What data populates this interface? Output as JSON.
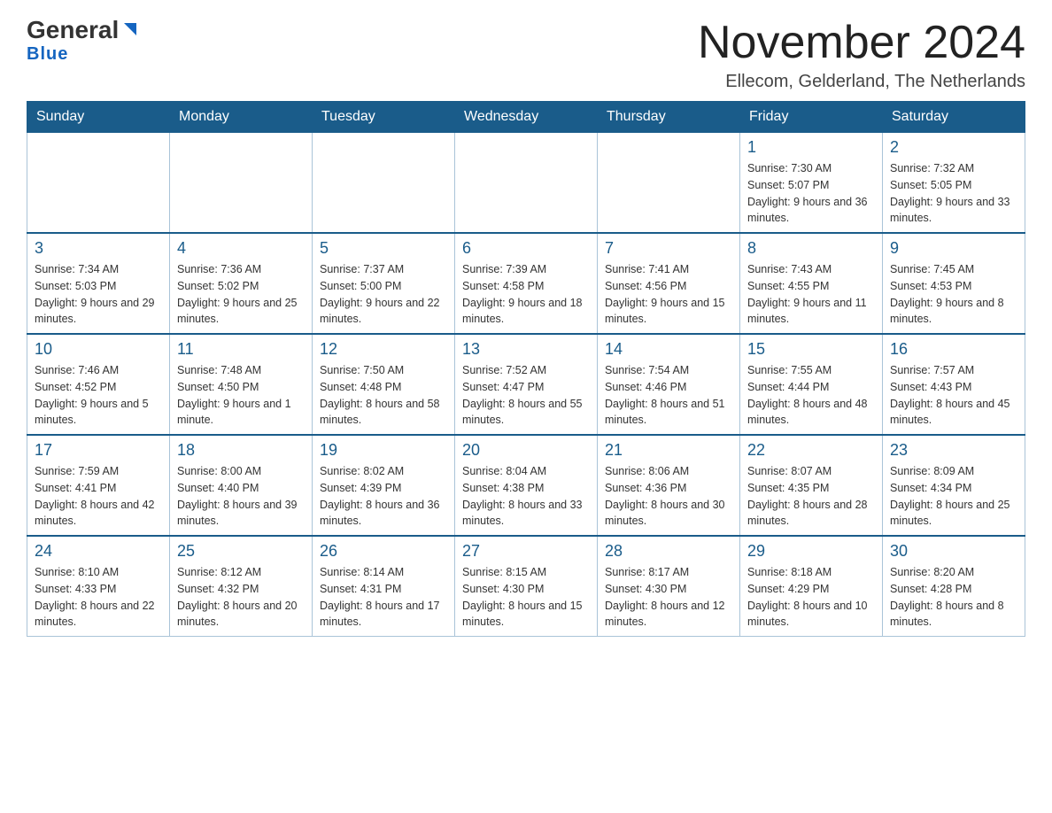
{
  "logo": {
    "name_part1": "General",
    "name_part2": "Blue"
  },
  "title": "November 2024",
  "subtitle": "Ellecom, Gelderland, The Netherlands",
  "days_of_week": [
    "Sunday",
    "Monday",
    "Tuesday",
    "Wednesday",
    "Thursday",
    "Friday",
    "Saturday"
  ],
  "weeks": [
    [
      {
        "day": "",
        "info": ""
      },
      {
        "day": "",
        "info": ""
      },
      {
        "day": "",
        "info": ""
      },
      {
        "day": "",
        "info": ""
      },
      {
        "day": "",
        "info": ""
      },
      {
        "day": "1",
        "info": "Sunrise: 7:30 AM\nSunset: 5:07 PM\nDaylight: 9 hours and 36 minutes."
      },
      {
        "day": "2",
        "info": "Sunrise: 7:32 AM\nSunset: 5:05 PM\nDaylight: 9 hours and 33 minutes."
      }
    ],
    [
      {
        "day": "3",
        "info": "Sunrise: 7:34 AM\nSunset: 5:03 PM\nDaylight: 9 hours and 29 minutes."
      },
      {
        "day": "4",
        "info": "Sunrise: 7:36 AM\nSunset: 5:02 PM\nDaylight: 9 hours and 25 minutes."
      },
      {
        "day": "5",
        "info": "Sunrise: 7:37 AM\nSunset: 5:00 PM\nDaylight: 9 hours and 22 minutes."
      },
      {
        "day": "6",
        "info": "Sunrise: 7:39 AM\nSunset: 4:58 PM\nDaylight: 9 hours and 18 minutes."
      },
      {
        "day": "7",
        "info": "Sunrise: 7:41 AM\nSunset: 4:56 PM\nDaylight: 9 hours and 15 minutes."
      },
      {
        "day": "8",
        "info": "Sunrise: 7:43 AM\nSunset: 4:55 PM\nDaylight: 9 hours and 11 minutes."
      },
      {
        "day": "9",
        "info": "Sunrise: 7:45 AM\nSunset: 4:53 PM\nDaylight: 9 hours and 8 minutes."
      }
    ],
    [
      {
        "day": "10",
        "info": "Sunrise: 7:46 AM\nSunset: 4:52 PM\nDaylight: 9 hours and 5 minutes."
      },
      {
        "day": "11",
        "info": "Sunrise: 7:48 AM\nSunset: 4:50 PM\nDaylight: 9 hours and 1 minute."
      },
      {
        "day": "12",
        "info": "Sunrise: 7:50 AM\nSunset: 4:48 PM\nDaylight: 8 hours and 58 minutes."
      },
      {
        "day": "13",
        "info": "Sunrise: 7:52 AM\nSunset: 4:47 PM\nDaylight: 8 hours and 55 minutes."
      },
      {
        "day": "14",
        "info": "Sunrise: 7:54 AM\nSunset: 4:46 PM\nDaylight: 8 hours and 51 minutes."
      },
      {
        "day": "15",
        "info": "Sunrise: 7:55 AM\nSunset: 4:44 PM\nDaylight: 8 hours and 48 minutes."
      },
      {
        "day": "16",
        "info": "Sunrise: 7:57 AM\nSunset: 4:43 PM\nDaylight: 8 hours and 45 minutes."
      }
    ],
    [
      {
        "day": "17",
        "info": "Sunrise: 7:59 AM\nSunset: 4:41 PM\nDaylight: 8 hours and 42 minutes."
      },
      {
        "day": "18",
        "info": "Sunrise: 8:00 AM\nSunset: 4:40 PM\nDaylight: 8 hours and 39 minutes."
      },
      {
        "day": "19",
        "info": "Sunrise: 8:02 AM\nSunset: 4:39 PM\nDaylight: 8 hours and 36 minutes."
      },
      {
        "day": "20",
        "info": "Sunrise: 8:04 AM\nSunset: 4:38 PM\nDaylight: 8 hours and 33 minutes."
      },
      {
        "day": "21",
        "info": "Sunrise: 8:06 AM\nSunset: 4:36 PM\nDaylight: 8 hours and 30 minutes."
      },
      {
        "day": "22",
        "info": "Sunrise: 8:07 AM\nSunset: 4:35 PM\nDaylight: 8 hours and 28 minutes."
      },
      {
        "day": "23",
        "info": "Sunrise: 8:09 AM\nSunset: 4:34 PM\nDaylight: 8 hours and 25 minutes."
      }
    ],
    [
      {
        "day": "24",
        "info": "Sunrise: 8:10 AM\nSunset: 4:33 PM\nDaylight: 8 hours and 22 minutes."
      },
      {
        "day": "25",
        "info": "Sunrise: 8:12 AM\nSunset: 4:32 PM\nDaylight: 8 hours and 20 minutes."
      },
      {
        "day": "26",
        "info": "Sunrise: 8:14 AM\nSunset: 4:31 PM\nDaylight: 8 hours and 17 minutes."
      },
      {
        "day": "27",
        "info": "Sunrise: 8:15 AM\nSunset: 4:30 PM\nDaylight: 8 hours and 15 minutes."
      },
      {
        "day": "28",
        "info": "Sunrise: 8:17 AM\nSunset: 4:30 PM\nDaylight: 8 hours and 12 minutes."
      },
      {
        "day": "29",
        "info": "Sunrise: 8:18 AM\nSunset: 4:29 PM\nDaylight: 8 hours and 10 minutes."
      },
      {
        "day": "30",
        "info": "Sunrise: 8:20 AM\nSunset: 4:28 PM\nDaylight: 8 hours and 8 minutes."
      }
    ]
  ]
}
